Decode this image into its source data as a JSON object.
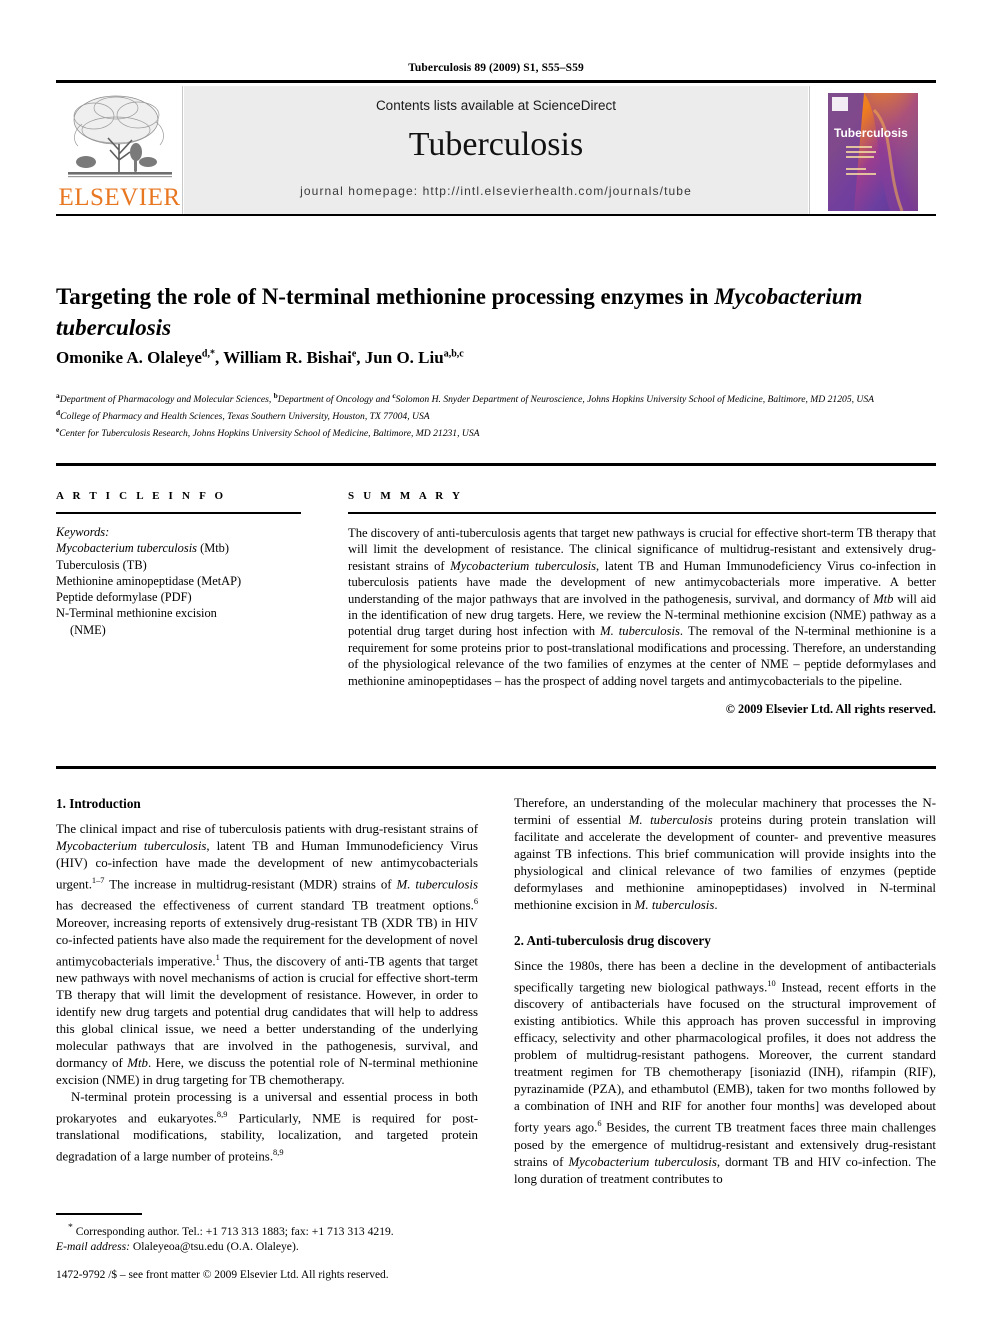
{
  "running_head": "Tuberculosis 89 (2009) S1, S55–S59",
  "masthead": {
    "publisher_name": "ELSEVIER",
    "contents_line": "Contents lists available at ScienceDirect",
    "journal_title": "Tuberculosis",
    "homepage_label": "journal homepage: http://intl.elsevierhealth.com/journals/tube",
    "cover_title": "Tuberculosis",
    "cover_colors": {
      "purple": "#6b3fa0",
      "orange": "#f08a1e",
      "magenta": "#b5348c"
    },
    "panel_bg": "#ececec",
    "brand_orange": "#e87722"
  },
  "title": {
    "part1": "Targeting the role of N-terminal methionine processing enzymes in ",
    "italic": "Mycobacterium tuberculosis"
  },
  "authors": {
    "a1_name": "Omonike A. Olaleye",
    "a1_sup": "d,",
    "a1_star": "*",
    "a2_name": "William R. Bishai",
    "a2_sup": "e",
    "a3_name": "Jun O. Liu",
    "a3_sup": "a,b,c"
  },
  "affiliations": [
    {
      "sup_a": "a",
      "text_a": "Department of Pharmacology and Molecular Sciences, ",
      "sup_b": "b",
      "text_b": "Department of Oncology and ",
      "sup_c": "c",
      "text_c": "Solomon H. Snyder Department of Neuroscience, Johns Hopkins University School of Medicine, Baltimore, MD 21205, USA"
    },
    {
      "sup": "d",
      "text": "College of Pharmacy and Health Sciences, Texas Southern University, Houston, TX 77004, USA"
    },
    {
      "sup": "e",
      "text": "Center for Tuberculosis Research, Johns Hopkins University School of Medicine, Baltimore, MD 21231, USA"
    }
  ],
  "article_info": {
    "heading": "A R T I C L E   I N F O",
    "keywords_label": "Keywords:",
    "keywords": [
      {
        "italic": "Mycobacterium tuberculosis",
        "plain": " (Mtb)"
      },
      {
        "italic": "",
        "plain": "Tuberculosis (TB)"
      },
      {
        "italic": "",
        "plain": "Methionine aminopeptidase (MetAP)"
      },
      {
        "italic": "",
        "plain": "Peptide deformylase (PDF)"
      },
      {
        "italic": "",
        "plain": "N-Terminal methionine excision"
      },
      {
        "italic": "",
        "plain": "(NME)",
        "indent": true
      }
    ]
  },
  "summary": {
    "heading": "S U M M A R Y",
    "p1": "The discovery of anti-tuberculosis agents that target new pathways is crucial for effective short-term TB therapy that will limit the development of resistance. The clinical significance of multidrug-resistant and extensively drug-resistant strains of ",
    "p1_ital": "Mycobacterium tuberculosis",
    "p2": ", latent TB and Human Immunodeficiency Virus co-infection in tuberculosis patients have made the development of new antimycobacterials more imperative. A better understanding of the major pathways that are involved in the pathogenesis, survival, and dormancy of ",
    "p2_ital": "Mtb",
    "p3": " will aid in the identification of new drug targets. Here, we review the N-terminal methionine excision (NME) pathway as a potential drug target during host infection with ",
    "p3_ital": "M. tuberculosis",
    "p4": ". The removal of the N-terminal methionine is a requirement for some proteins prior to post-translational modifications and processing. Therefore, an understanding of the physiological relevance of the two families of enzymes at the center of NME – peptide deformylases and methionine aminopeptidases – has the prospect of adding novel targets and antimycobacterials to the pipeline.",
    "copyright": "© 2009 Elsevier Ltd. All rights reserved."
  },
  "sections": {
    "intro_heading": "1. Introduction",
    "intro_p1_a": "The clinical impact and rise of tuberculosis patients with drug-resistant strains of ",
    "intro_p1_ital1": "Mycobacterium tuberculosis",
    "intro_p1_b": ", latent TB and Human Immunodeficiency Virus (HIV) co-infection have made the development of new antimycobacterials urgent.",
    "intro_p1_sup1": "1–7",
    "intro_p1_c": " The increase in multidrug-resistant (MDR) strains of ",
    "intro_p1_ital2": "M. tuberculosis",
    "intro_p1_d": " has decreased the effectiveness of current standard TB treatment options.",
    "intro_p1_sup2": "6",
    "intro_p1_e": " Moreover, increasing reports of extensively drug-resistant TB (XDR TB) in HIV co-infected patients have also made the requirement for the development of novel antimycobacterials imperative.",
    "intro_p1_sup3": "1",
    "intro_p1_f": " Thus, the discovery of anti-TB agents that target new pathways with novel mechanisms of action is crucial for effective short-term TB therapy that will limit the development of resistance. However, in order to identify new drug targets and potential drug candidates that will help to address this global clinical issue, we need a better understanding of the underlying molecular pathways that are involved in the pathogenesis, survival, and dormancy of ",
    "intro_p1_ital3": "Mtb",
    "intro_p1_g": ". Here, we discuss the potential role of N-terminal methionine excision (NME) in drug targeting for TB chemotherapy.",
    "intro_p2_a": "N-terminal protein processing is a universal and essential process in both prokaryotes and eukaryotes.",
    "intro_p2_sup1": "8,9",
    "intro_p2_b": " Particularly, NME is required for post-translational modifications, stability, localization, and targeted protein degradation of a large number of proteins.",
    "intro_p2_sup2": "8,9",
    "right_p1_a": "Therefore, an understanding of the molecular machinery that processes the N-termini of essential ",
    "right_p1_ital1": "M. tuberculosis",
    "right_p1_b": " proteins during protein translation will facilitate and accelerate the development of counter- and preventive measures against TB infections. This brief communication will provide insights into the physiological and clinical relevance of two families of enzymes (peptide deformylases and methionine aminopeptidases) involved in N-terminal methionine excision in ",
    "right_p1_ital2": "M. tuberculosis",
    "right_p1_c": ".",
    "drug_heading": "2. Anti-tuberculosis drug discovery",
    "drug_p1_a": "Since the 1980s, there has been a decline in the development of antibacterials specifically targeting new biological pathways.",
    "drug_p1_sup1": "10",
    "drug_p1_b": " Instead, recent efforts in the discovery of antibacterials have focused on the structural improvement of existing antibiotics. While this approach has proven successful in improving efficacy, selectivity and other pharmacological profiles, it does not address the problem of multidrug-resistant pathogens. Moreover, the current standard treatment regimen for TB chemotherapy [isoniazid (INH), rifampin (RIF), pyrazinamide (PZA), and ethambutol (EMB), taken for two months followed by a combination of INH and RIF for another four months] was developed about forty years ago.",
    "drug_p1_sup2": "6",
    "drug_p1_c": " Besides, the current TB treatment faces three main challenges posed by the emergence of multidrug-resistant and extensively drug-resistant strains of ",
    "drug_p1_ital1": "Mycobacterium tuberculosis",
    "drug_p1_d": ", dormant TB and HIV co-infection. The long duration of treatment contributes to"
  },
  "footnote": {
    "star": "*",
    "corresponding": " Corresponding author. Tel.: +1 713 313 1883; fax: +1 713 313 4219.",
    "email_label": "E-mail address:",
    "email_value": " Olaleyeoa@tsu.edu (O.A. Olaleye).",
    "issn_line": "1472-9792 /$ – see front matter © 2009 Elsevier Ltd. All rights reserved."
  }
}
